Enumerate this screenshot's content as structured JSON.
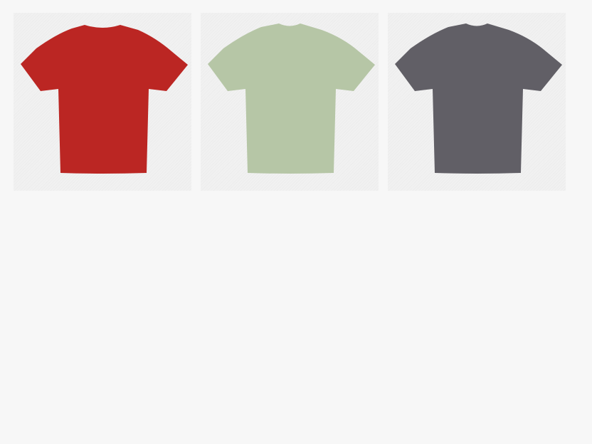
{
  "products": [
    {
      "color_name": "red",
      "color": "#bb2623"
    },
    {
      "color_name": "sage-green",
      "color": "#b6c6a6"
    },
    {
      "color_name": "charcoal-gray",
      "color": "#615f66"
    }
  ]
}
